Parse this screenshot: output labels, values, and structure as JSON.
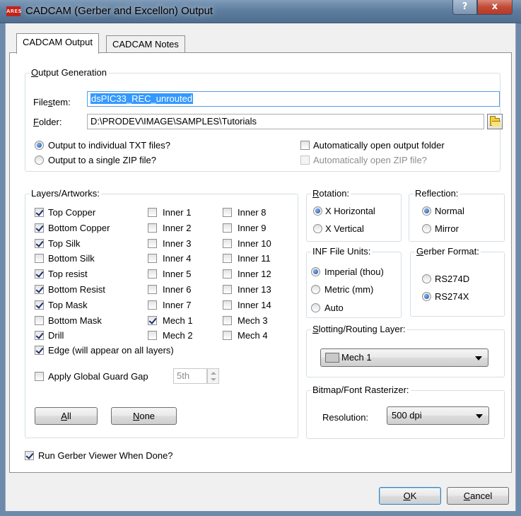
{
  "window": {
    "title": "CADCAM (Gerber and Excellon) Output",
    "app_icon_text": "ARES",
    "help_glyph": "?",
    "close_glyph": "x"
  },
  "tabs": [
    {
      "label": "CADCAM Output",
      "active": true
    },
    {
      "label": "CADCAM Notes",
      "active": false
    }
  ],
  "output_generation": {
    "title_key": "O",
    "title_rest": "utput Generation",
    "filestem_label_pre": "File",
    "filestem_label_key": "s",
    "filestem_label_post": "tem:",
    "filestem_value": "dsPIC33_REC_unrouted",
    "folder_label_key": "F",
    "folder_label_post": "older:",
    "folder_value": "D:\\PRODEV\\IMAGE\\SAMPLES\\Tutorials",
    "radio_individual": {
      "label": "Output to individual TXT files?",
      "checked": true
    },
    "radio_zip": {
      "label": "Output to a single ZIP file?",
      "checked": false
    },
    "auto_open_folder": {
      "label": "Automatically open output folder",
      "checked": false
    },
    "auto_open_zip": {
      "label": "Automatically open ZIP file?",
      "checked": false,
      "disabled": true
    }
  },
  "layers": {
    "title": "Layers/Artworks:",
    "col1": [
      {
        "label": "Top Copper",
        "checked": true
      },
      {
        "label": "Bottom Copper",
        "checked": true
      },
      {
        "label": "Top Silk",
        "checked": true
      },
      {
        "label": "Bottom Silk",
        "checked": false
      },
      {
        "label": "Top resist",
        "checked": true
      },
      {
        "label": "Bottom Resist",
        "checked": true
      },
      {
        "label": "Top Mask",
        "checked": true
      },
      {
        "label": "Bottom Mask",
        "checked": false
      },
      {
        "label": "Drill",
        "checked": true
      }
    ],
    "col2": [
      {
        "label": "Inner 1",
        "checked": false
      },
      {
        "label": "Inner 2",
        "checked": false
      },
      {
        "label": "Inner 3",
        "checked": false
      },
      {
        "label": "Inner 4",
        "checked": false
      },
      {
        "label": "Inner 5",
        "checked": false
      },
      {
        "label": "Inner 6",
        "checked": false
      },
      {
        "label": "Inner 7",
        "checked": false
      },
      {
        "label": "Mech 1",
        "checked": true
      },
      {
        "label": "Mech 2",
        "checked": false
      }
    ],
    "col3": [
      {
        "label": "Inner 8",
        "checked": false
      },
      {
        "label": "Inner 9",
        "checked": false
      },
      {
        "label": "Inner 10",
        "checked": false
      },
      {
        "label": "Inner 11",
        "checked": false
      },
      {
        "label": "Inner 12",
        "checked": false
      },
      {
        "label": "Inner 13",
        "checked": false
      },
      {
        "label": "Inner 14",
        "checked": false
      },
      {
        "label": "Mech 3",
        "checked": false
      },
      {
        "label": "Mech 4",
        "checked": false
      }
    ],
    "edge": {
      "label": "Edge (will appear on all layers)",
      "checked": true
    },
    "guard_gap": {
      "label": "Apply Global Guard Gap",
      "checked": false,
      "value": "5th"
    },
    "all_button_key": "A",
    "all_button_rest": "ll",
    "none_button_key": "N",
    "none_button_rest": "one"
  },
  "rotation": {
    "title_key": "R",
    "title_rest": "otation:",
    "options": [
      {
        "label": "X Horizontal",
        "checked": true
      },
      {
        "label": "X Vertical",
        "checked": false
      }
    ]
  },
  "reflection": {
    "title": "Reflection:",
    "options": [
      {
        "label": "Normal",
        "checked": true
      },
      {
        "label": "Mirror",
        "checked": false
      }
    ]
  },
  "inf_units": {
    "title": "INF File Units:",
    "options": [
      {
        "label": "Imperial (thou)",
        "checked": true
      },
      {
        "label": "Metric (mm)",
        "checked": false
      },
      {
        "label": "Auto",
        "checked": false
      }
    ]
  },
  "gerber_format": {
    "title_key": "G",
    "title_rest": "erber Format:",
    "options": [
      {
        "label": "RS274D",
        "checked": false
      },
      {
        "label": "RS274X",
        "checked": true
      }
    ]
  },
  "slotting": {
    "title_key": "S",
    "title_rest": "lotting/Routing Layer:",
    "selected": "Mech 1",
    "swatch_color": "#c8c8c8"
  },
  "bitmap": {
    "title": "Bitmap/Font Rasterizer:",
    "resolution_label": "Resolution:",
    "resolution_value": "500 dpi"
  },
  "run_viewer": {
    "label": "Run Gerber Viewer When Done?",
    "checked": true
  },
  "footer": {
    "ok_key": "O",
    "ok_rest": "K",
    "cancel_key": "C",
    "cancel_rest": "ancel"
  },
  "colors": {
    "title_bar": "#5f7d9e",
    "close_button": "#c24a37",
    "selection": "#3399ff",
    "dialog_bg": "#f0f0f0",
    "panel_bg": "#ffffff"
  }
}
